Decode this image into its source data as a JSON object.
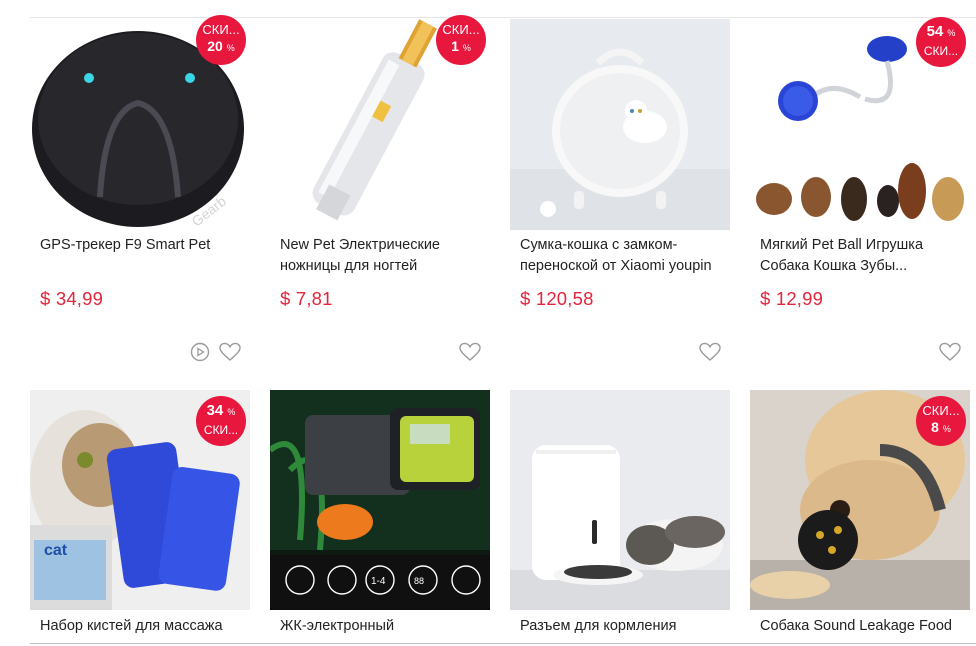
{
  "products": [
    {
      "name": "GPS-трекер F9 Smart Pet",
      "price": "$ 34,99",
      "badge": {
        "line1": "СКИ...",
        "line2": "20",
        "pct": "%"
      },
      "has_video": true,
      "image": "black-pet-gps-tracker"
    },
    {
      "name": "New Pet Электрические ножницы для ногтей",
      "price": "$ 7,81",
      "badge": {
        "line1": "СКИ...",
        "line2": "1",
        "pct": "%"
      },
      "has_video": false,
      "image": "white-electric-nail-trimmer"
    },
    {
      "name": "Сумка-кошка с замком-переноской от Xiaomi youpin",
      "price": "$ 120,58",
      "badge": null,
      "has_video": false,
      "image": "white-space-capsule-cat-carrier"
    },
    {
      "name": "Мягкий Pet Ball Игрушка Собака Кошка Зубы...",
      "price": "$ 12,99",
      "badge": {
        "line1": "54",
        "pct": "%",
        "line2": "СКИ..."
      },
      "has_video": false,
      "image": "blue-rope-ball-toy-with-dogs"
    },
    {
      "name": "Набор кистей для массажа",
      "badge": {
        "line1": "34",
        "pct": "%",
        "line2": "СКИ..."
      },
      "image": "cat-self-groomer-brush"
    },
    {
      "name": "ЖК-электронный",
      "badge": null,
      "image": "lcd-automatic-fish-feeder"
    },
    {
      "name": "Разъем для кормления",
      "badge": null,
      "image": "smart-pet-feeder-with-cat"
    },
    {
      "name": "Собака Sound Leakage Food",
      "badge": {
        "line1": "СКИ...",
        "line2": "8",
        "pct": "%"
      },
      "image": "dog-with-black-treat-ball"
    }
  ],
  "colors": {
    "price": "#e2253c",
    "badge": "#e8173e",
    "icon_outline": "#9a9a9a"
  },
  "icons": {
    "favorite": "heart-outline-icon",
    "video": "play-circle-icon"
  }
}
